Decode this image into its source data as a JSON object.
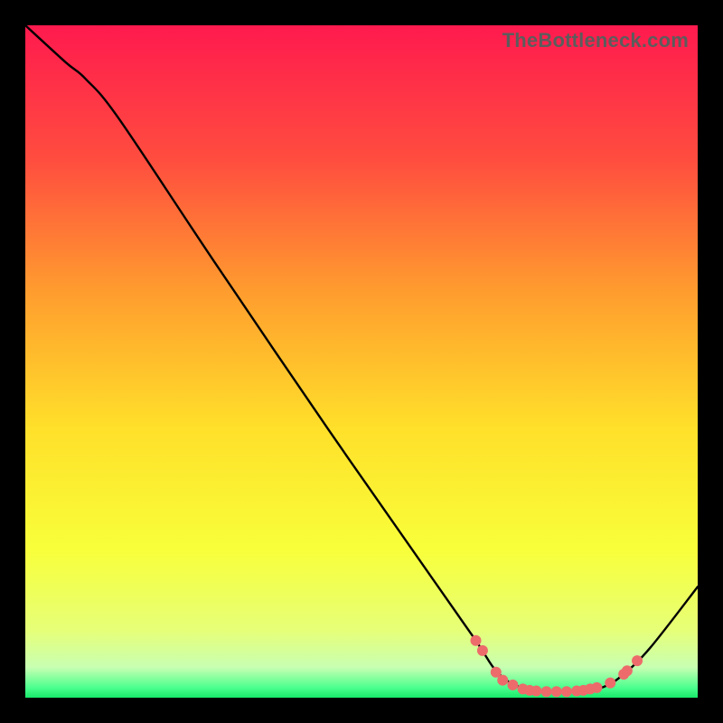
{
  "watermark": "TheBottleneck.com",
  "chart_data": {
    "type": "line",
    "title": "",
    "xlabel": "",
    "ylabel": "",
    "xlim": [
      0,
      100
    ],
    "ylim": [
      0,
      100
    ],
    "gradient_stops": [
      {
        "offset": 0.0,
        "color": "#ff1a4e"
      },
      {
        "offset": 0.2,
        "color": "#ff4d3f"
      },
      {
        "offset": 0.4,
        "color": "#ff9e2e"
      },
      {
        "offset": 0.6,
        "color": "#ffe02a"
      },
      {
        "offset": 0.78,
        "color": "#f8ff3a"
      },
      {
        "offset": 0.9,
        "color": "#e6ff78"
      },
      {
        "offset": 0.955,
        "color": "#c8ffb2"
      },
      {
        "offset": 0.985,
        "color": "#4cff8e"
      },
      {
        "offset": 1.0,
        "color": "#17e86b"
      }
    ],
    "curve": [
      {
        "x": 0.0,
        "y": 100.0
      },
      {
        "x": 6.0,
        "y": 94.5
      },
      {
        "x": 9.0,
        "y": 92.0
      },
      {
        "x": 14.0,
        "y": 86.0
      },
      {
        "x": 28.0,
        "y": 65.0
      },
      {
        "x": 45.0,
        "y": 40.0
      },
      {
        "x": 60.0,
        "y": 18.5
      },
      {
        "x": 67.0,
        "y": 8.5
      },
      {
        "x": 70.0,
        "y": 4.0
      },
      {
        "x": 73.0,
        "y": 1.8
      },
      {
        "x": 77.0,
        "y": 0.9
      },
      {
        "x": 82.0,
        "y": 0.9
      },
      {
        "x": 86.0,
        "y": 1.6
      },
      {
        "x": 89.0,
        "y": 3.5
      },
      {
        "x": 93.0,
        "y": 7.5
      },
      {
        "x": 100.0,
        "y": 16.5
      }
    ],
    "marker_color": "#ed6b6b",
    "marker_radius_px": 6,
    "markers": [
      {
        "x": 67.0,
        "y": 8.5
      },
      {
        "x": 68.0,
        "y": 7.0
      },
      {
        "x": 70.0,
        "y": 3.8
      },
      {
        "x": 71.0,
        "y": 2.6
      },
      {
        "x": 72.5,
        "y": 1.9
      },
      {
        "x": 74.0,
        "y": 1.3
      },
      {
        "x": 75.0,
        "y": 1.1
      },
      {
        "x": 76.0,
        "y": 1.0
      },
      {
        "x": 77.5,
        "y": 0.9
      },
      {
        "x": 79.0,
        "y": 0.9
      },
      {
        "x": 80.5,
        "y": 0.9
      },
      {
        "x": 82.0,
        "y": 1.0
      },
      {
        "x": 83.0,
        "y": 1.1
      },
      {
        "x": 84.0,
        "y": 1.3
      },
      {
        "x": 85.0,
        "y": 1.5
      },
      {
        "x": 87.0,
        "y": 2.2
      },
      {
        "x": 89.0,
        "y": 3.5
      },
      {
        "x": 89.5,
        "y": 4.0
      },
      {
        "x": 91.0,
        "y": 5.5
      }
    ]
  }
}
